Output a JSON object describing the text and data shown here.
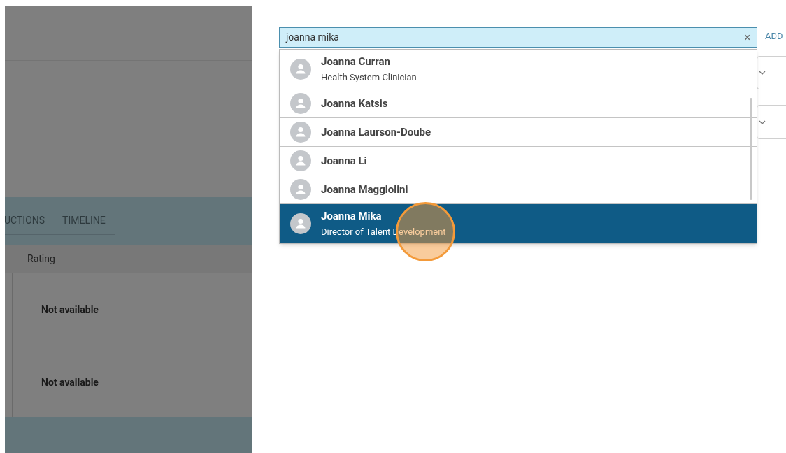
{
  "background_panel": {
    "tabs": [
      {
        "label": "UCTIONS",
        "selected": false
      },
      {
        "label": "TIMELINE",
        "selected": false
      }
    ],
    "table": {
      "columns": [
        "Rating"
      ],
      "rows": [
        {
          "rating": "Not available"
        },
        {
          "rating": "Not available"
        }
      ]
    }
  },
  "search": {
    "value": "joanna mika",
    "clear": "×"
  },
  "add_button": "ADD",
  "results": [
    {
      "name": "Joanna Curran",
      "title": "Health System Clinician",
      "selected": false
    },
    {
      "name": "Joanna Katsis",
      "selected": false
    },
    {
      "name": "Joanna Laurson-Doube",
      "selected": false
    },
    {
      "name": "Joanna Li",
      "selected": false
    },
    {
      "name": "Joanna Maggiolini",
      "selected": false
    },
    {
      "name": "Joanna Mika",
      "title": "Director of Talent Development",
      "selected": true
    }
  ]
}
